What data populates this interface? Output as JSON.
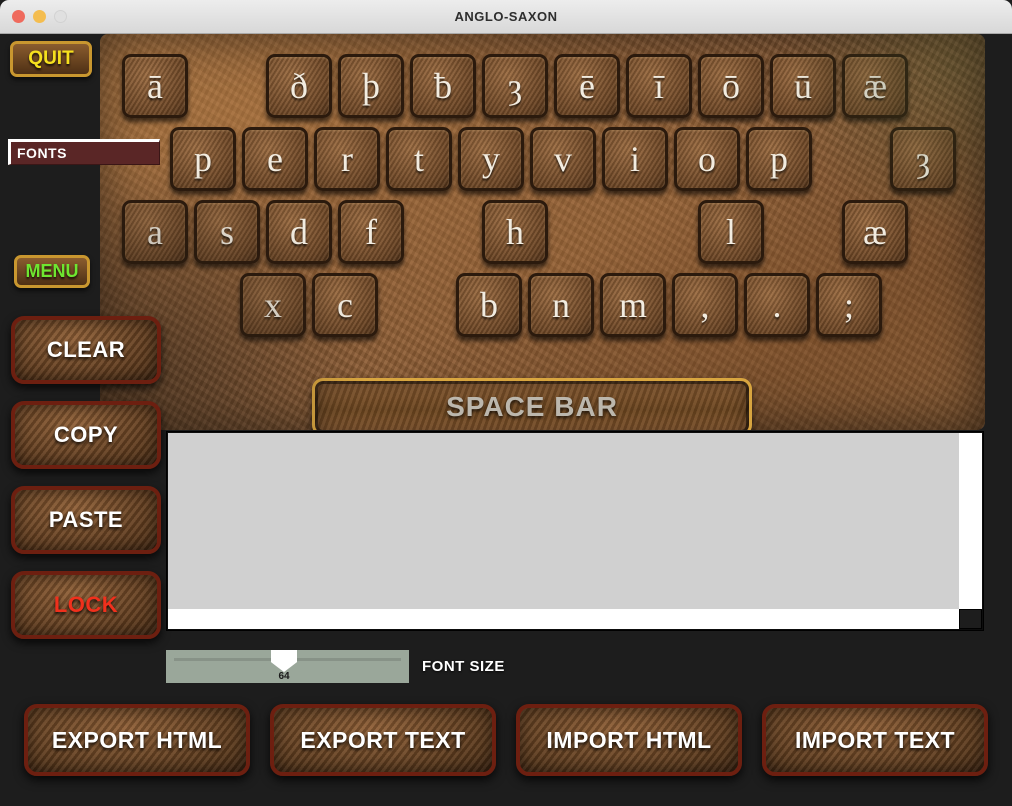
{
  "window": {
    "title": "ANGLO-SAXON",
    "traffic_lights": [
      "close",
      "minimize",
      "zoom"
    ]
  },
  "sidebar": {
    "quit_label": "QUIT",
    "fonts_label": "FONTS",
    "menu_label": "MENU",
    "actions": [
      {
        "label": "CLEAR",
        "color": "#ffffff"
      },
      {
        "label": "COPY",
        "color": "#ffffff"
      },
      {
        "label": "PASTE",
        "color": "#ffffff"
      },
      {
        "label": "LOCK",
        "color": "#f0301c"
      }
    ]
  },
  "keyboard": {
    "rows": [
      {
        "keys": [
          "ā",
          "",
          "ð",
          "þ",
          "ƀ",
          "ȝ",
          "ē",
          "ī",
          "ō",
          "ū",
          "ǣ"
        ]
      },
      {
        "keys": [
          "p",
          "e",
          "r",
          "t",
          "y",
          "v",
          "i",
          "o",
          "p",
          "",
          "ȝ"
        ]
      },
      {
        "keys": [
          "a",
          "s",
          "d",
          "f",
          "",
          "h",
          "",
          "",
          "l",
          "",
          "æ"
        ]
      },
      {
        "keys": [
          "x",
          "c",
          "",
          "b",
          "n",
          "m",
          ",",
          ".",
          ";"
        ]
      }
    ],
    "spacebar_label": "SPACE BAR"
  },
  "editor": {
    "content": "",
    "background_color": "#d0d0d0"
  },
  "font_size": {
    "label": "FONT SIZE",
    "value": "64",
    "min": "0",
    "max": "144"
  },
  "bottom_bar": {
    "buttons": [
      {
        "label": "EXPORT HTML"
      },
      {
        "label": "EXPORT TEXT"
      },
      {
        "label": "IMPORT HTML"
      },
      {
        "label": "IMPORT TEXT"
      }
    ]
  },
  "colors": {
    "app_background": "#1d1d1d",
    "accent_gold": "#c9972f",
    "quit_text": "#f6e01e",
    "menu_text": "#6ee630",
    "lock_text": "#f0301c",
    "fonts_field": "#5a2626"
  }
}
